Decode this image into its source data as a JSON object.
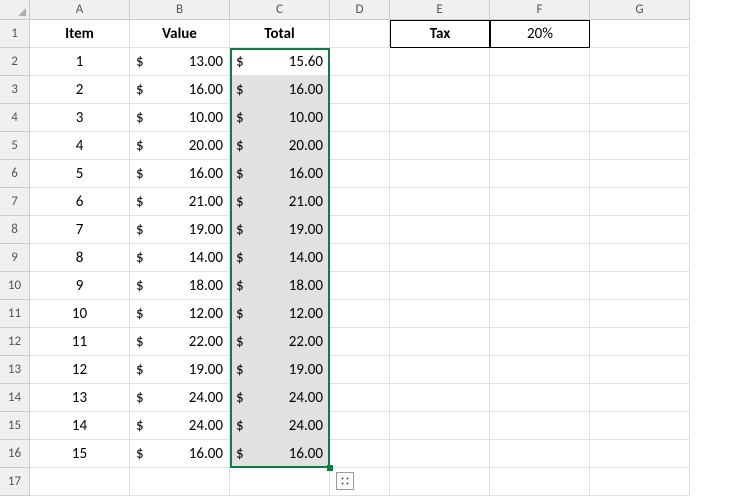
{
  "columns": [
    "A",
    "B",
    "C",
    "D",
    "E",
    "F",
    "G"
  ],
  "headers": {
    "A": "Item",
    "B": "Value",
    "C": "Total",
    "E": "Tax",
    "F": "20%"
  },
  "rows": [
    {
      "item": "1",
      "value": "13.00",
      "total": "15.60"
    },
    {
      "item": "2",
      "value": "16.00",
      "total": "16.00"
    },
    {
      "item": "3",
      "value": "10.00",
      "total": "10.00"
    },
    {
      "item": "4",
      "value": "20.00",
      "total": "20.00"
    },
    {
      "item": "5",
      "value": "16.00",
      "total": "16.00"
    },
    {
      "item": "6",
      "value": "21.00",
      "total": "21.00"
    },
    {
      "item": "7",
      "value": "19.00",
      "total": "19.00"
    },
    {
      "item": "8",
      "value": "14.00",
      "total": "14.00"
    },
    {
      "item": "9",
      "value": "18.00",
      "total": "18.00"
    },
    {
      "item": "10",
      "value": "12.00",
      "total": "12.00"
    },
    {
      "item": "11",
      "value": "22.00",
      "total": "22.00"
    },
    {
      "item": "12",
      "value": "19.00",
      "total": "19.00"
    },
    {
      "item": "13",
      "value": "24.00",
      "total": "24.00"
    },
    {
      "item": "14",
      "value": "24.00",
      "total": "24.00"
    },
    {
      "item": "15",
      "value": "16.00",
      "total": "16.00"
    }
  ],
  "currency": "$",
  "dataRowCount": 15,
  "emptyRowCount": 1
}
